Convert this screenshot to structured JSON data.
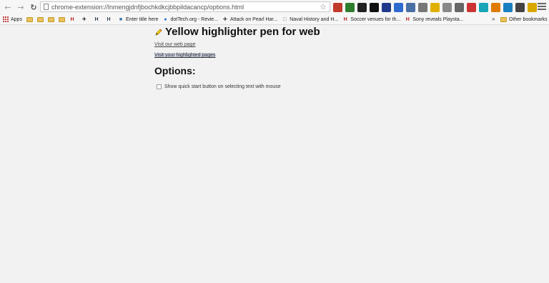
{
  "toolbar": {
    "back_icon": "back-arrow-icon",
    "forward_icon": "forward-arrow-icon",
    "reload_icon": "reload-icon",
    "url": "chrome-extension://lnmengjdnfjbochkdkcjbbpildacancp/options.html",
    "extensions": [
      {
        "name": "news-extension-icon",
        "color": "#c0392b"
      },
      {
        "name": "mixed-extension-icon",
        "color": "#2d7d2d"
      },
      {
        "name": "sun-extension-icon",
        "color": "#222222"
      },
      {
        "name": "cat-extension-icon",
        "color": "#111111"
      },
      {
        "name": "mask-extension-icon",
        "color": "#1f3a8a"
      },
      {
        "name": "tile-extension-icon",
        "color": "#2e6bd0"
      },
      {
        "name": "grid-extension-icon",
        "color": "#4a6fa5"
      },
      {
        "name": "check-extension-icon",
        "color": "#777777"
      },
      {
        "name": "star-extension-icon",
        "color": "#e0b000"
      },
      {
        "name": "pin-extension-icon",
        "color": "#888888"
      },
      {
        "name": "box-extension-icon",
        "color": "#666666"
      },
      {
        "name": "flag-extension-icon",
        "color": "#cc3333"
      },
      {
        "name": "e-extension-icon",
        "color": "#18a5b8"
      },
      {
        "name": "fire-extension-icon",
        "color": "#e07b00"
      },
      {
        "name": "circle-extension-icon",
        "color": "#1a7fc1"
      },
      {
        "name": "moon-extension-icon",
        "color": "#444444"
      },
      {
        "name": "pen-extension-icon",
        "color": "#d9a800"
      }
    ]
  },
  "bookmarks": {
    "apps_label": "Apps",
    "items": [
      {
        "label": "Enter title here",
        "icon": "bookmark-icon"
      },
      {
        "label": "dotTech.org - Revie...",
        "icon": "dottech-icon"
      },
      {
        "label": "Attack on Pearl Har...",
        "icon": "plane-icon"
      },
      {
        "label": "Naval History and H...",
        "icon": "page-icon"
      },
      {
        "label": "Soccer venues for th...",
        "icon": "h-icon"
      },
      {
        "label": "Sony reveals Playsta...",
        "icon": "h-icon"
      }
    ],
    "more_label": "»",
    "other_label": "Other bookmarks"
  },
  "content": {
    "title": "Yellow highlighter pen for web",
    "link1": "Visit our web page",
    "link2": "Visit your highlighted pages",
    "options_heading": "Options:",
    "option_label": "Show quick start button on selecting text with mouse",
    "option_checked": false
  }
}
